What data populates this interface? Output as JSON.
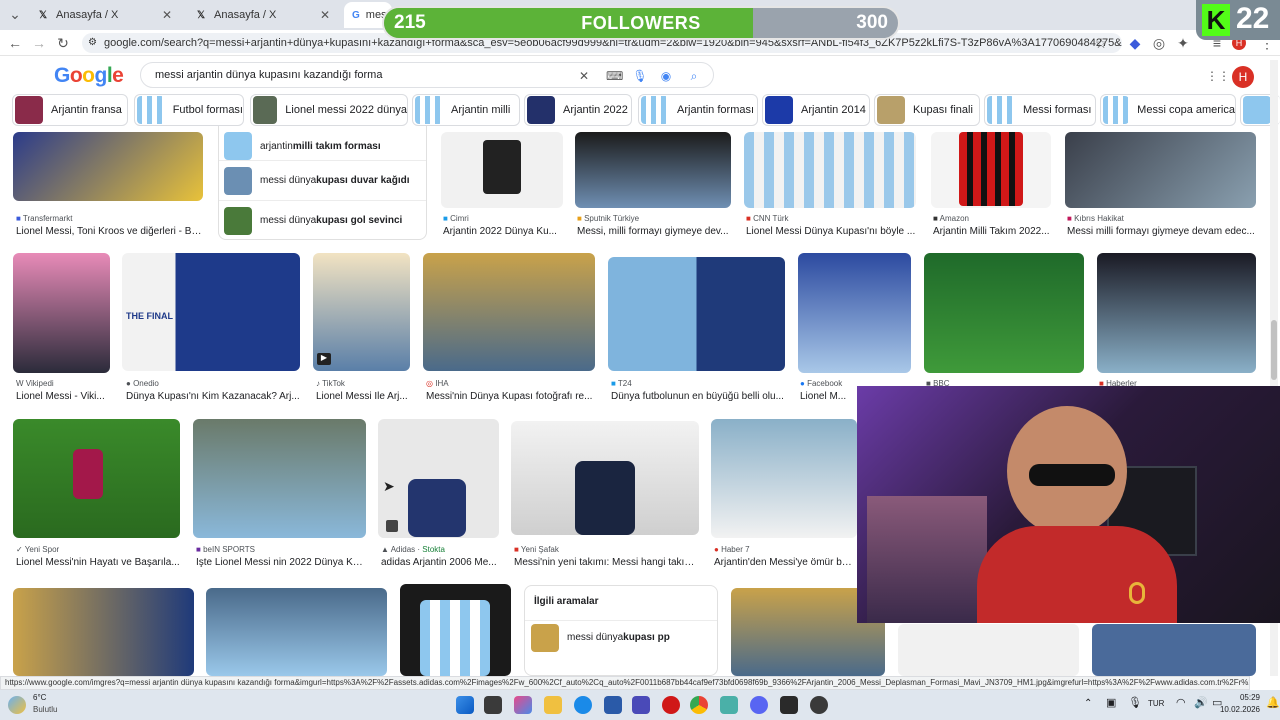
{
  "browser": {
    "tabs": [
      {
        "label": "Anasayfa / X"
      },
      {
        "label": "Anasayfa / X"
      },
      {
        "label": "messi"
      }
    ],
    "url": "google.com/search?q=messi+arjantin+dünya+kupasını+kazandığı+forma&sca_esv=5eob06acf99d999&hl=tr&udm=2&biw=1920&bih=945&sxsrf=ANbL-fi54f3_6ZK7P5z2kLfi7S-T3zP86vA%3A1770690484275&ei=tJeKaf7AEM_p7_UPvl..."
  },
  "google": {
    "logo": "Google",
    "query": "messi arjantin dünya kupasını kazandığı forma"
  },
  "chips": [
    {
      "label": "Arjantin fransa"
    },
    {
      "label": "Futbol forması"
    },
    {
      "label": "Lionel messi 2022 dünya"
    },
    {
      "label": "Arjantin milli"
    },
    {
      "label": "Arjantin 2022"
    },
    {
      "label": "Arjantin forması"
    },
    {
      "label": "Arjantin 2014"
    },
    {
      "label": "Kupası finali"
    },
    {
      "label": "Messi forması"
    },
    {
      "label": "Messi copa america"
    }
  ],
  "suggestions": [
    {
      "prefix": "arjantin ",
      "bold": "milli takım forması"
    },
    {
      "prefix": "messi dünya ",
      "bold": "kupası duvar kağıdı"
    },
    {
      "prefix": "messi dünya ",
      "bold": "kupası gol sevinci"
    }
  ],
  "row1": [
    {
      "source": "Transfermarkt",
      "title": "Lionel Messi, Toni Kroos ve diğerleri - Bu..."
    },
    {
      "source": "Cimri",
      "title": "Arjantin 2022 Dünya Ku..."
    },
    {
      "source": "Sputnik Türkiye",
      "title": "Messi, milli formayı giymeye dev..."
    },
    {
      "source": "CNN Türk",
      "title": "Lionel Messi Dünya Kupası'nı böyle ..."
    },
    {
      "source": "Amazon",
      "title": "Arjantin Milli Takım 2022..."
    },
    {
      "source": "Kıbrıs Hakikat",
      "title": "Messi milli formayı giymeye devam edec..."
    }
  ],
  "row2": [
    {
      "source": "Vikipedi",
      "title": "Lionel Messi - Viki..."
    },
    {
      "source": "Onedio",
      "title": "Dünya Kupası'nı Kim Kazanacak? Arj..."
    },
    {
      "source": "TikTok",
      "title": "Lionel Messi İle Arj..."
    },
    {
      "source": "IHA",
      "title": "Messi'nin Dünya Kupası fotoğrafı re..."
    },
    {
      "source": "T24",
      "title": "Dünya futbolunun en büyüğü belli olu..."
    },
    {
      "source": "Facebook",
      "title": "Lionel M..."
    },
    {
      "source": "BBC",
      "title": ""
    },
    {
      "source": "Haberler",
      "title": ""
    }
  ],
  "row3": [
    {
      "source": "Yeni Spor",
      "title": "Lionel Messi'nin Hayatı ve Başarıla..."
    },
    {
      "source": "beIN SPORTS",
      "title": "İşte Lionel Messi nin 2022 Dünya Ku..."
    },
    {
      "source": "Adidas",
      "stock": "Stokta",
      "title": "adidas Arjantin 2006 Me..."
    },
    {
      "source": "Yeni Şafak",
      "title": "Messi'nin yeni takımı: Messi hangi takım..."
    },
    {
      "source": "Haber 7",
      "title": "Arjantin'den Messi'ye ömür boyu ..."
    }
  ],
  "thumb_label": "THE FINAL",
  "related": {
    "heading": "İlgili aramalar",
    "items": [
      {
        "prefix": "messi dünya ",
        "bold": "kupası pp"
      }
    ]
  },
  "overlay": {
    "followers_label": "FOLLOWERS",
    "followers_current": "215",
    "followers_goal": "300",
    "progress": 0.717,
    "badge_count": "22",
    "badge_letter": "K"
  },
  "status_url": "https://www.google.com/imgres?q=messi arjantin dünya kupasını kazandığı forma&imgurl=https%3A%2F%2Fassets.adidas.com%2Fimages%2Fw_600%2Cf_auto%2Cq_auto%2F0011b687bb44caf9ef73bfd0698f69b_9366%2FArjantin_2006_Messi_Deplasman_Formasi_Mavi_JN3709_HM1.jpg&imgrefurl=https%3A%2F%2Fwww.adidas.com.tr%2Fr%2Farjantin...",
  "taskbar": {
    "weather_temp": "6°C",
    "weather_desc": "Bulutlu",
    "lang": "TUR",
    "time": "05:29",
    "date": "10.02.2026"
  },
  "colors": {
    "accent": "#1a73e8",
    "fill": "#5cb338",
    "brand_red": "#d93025"
  }
}
